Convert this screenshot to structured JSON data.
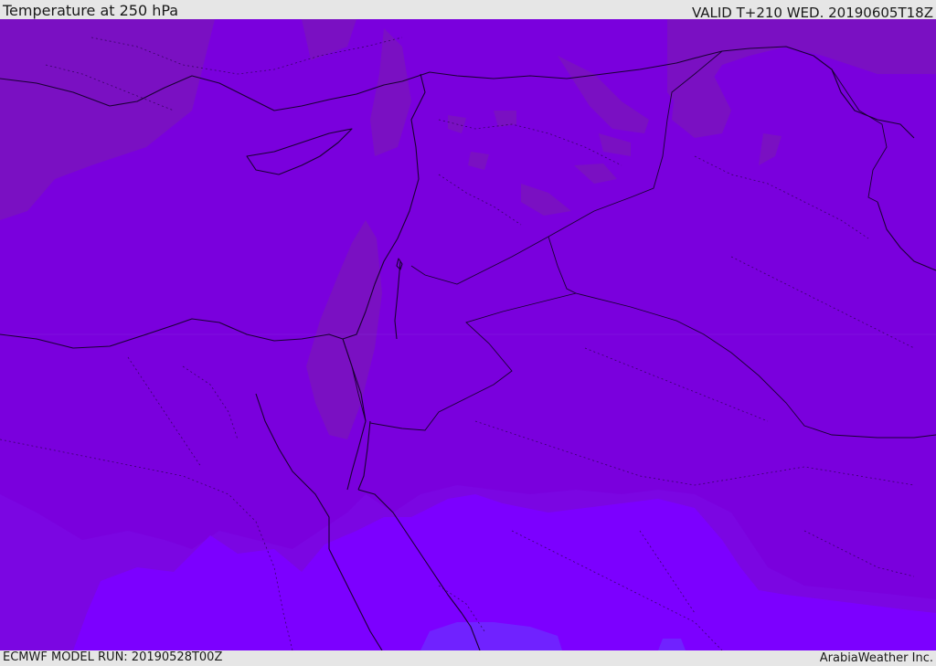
{
  "header": {
    "title": "Temperature at 250 hPa",
    "valid_time": "VALID T+210 WED. 20190605T18Z"
  },
  "footer": {
    "model_run": "ECMWF MODEL RUN: 20190528T00Z",
    "credit": "ArabiaWeather Inc."
  },
  "colors": {
    "base_field": "#7a00dd",
    "cold_band": "#7a10c2",
    "warm_band": "#7c00ff",
    "warmest_patch": "#7022ff",
    "coastline": "#1a0033"
  }
}
